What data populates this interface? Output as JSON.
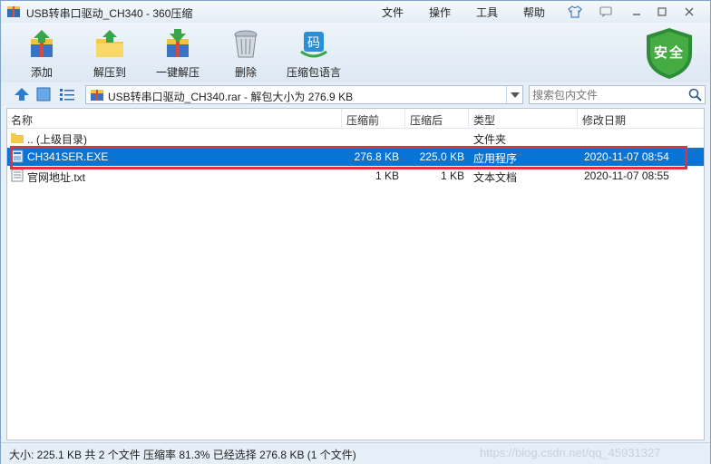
{
  "window": {
    "title": "USB转串口驱动_CH340 - 360压缩",
    "menu": [
      "文件",
      "操作",
      "工具",
      "帮助"
    ]
  },
  "toolbar": {
    "buttons": [
      {
        "label": "添加",
        "icon": "add-archive-icon"
      },
      {
        "label": "解压到",
        "icon": "extract-to-icon"
      },
      {
        "label": "一键解压",
        "icon": "one-click-extract-icon"
      },
      {
        "label": "删除",
        "icon": "trash-icon"
      },
      {
        "label": "压缩包语言",
        "icon": "archive-language-icon"
      }
    ],
    "badge_label": "安全"
  },
  "address": {
    "path": "USB转串口驱动_CH340.rar - 解包大小为 276.9 KB",
    "search_placeholder": "搜索包内文件"
  },
  "list": {
    "columns": [
      "名称",
      "压缩前",
      "压缩后",
      "类型",
      "修改日期"
    ],
    "rows": [
      {
        "name": ".. (上级目录)",
        "before": "",
        "after": "",
        "type": "文件夹",
        "date": "",
        "icon": "folder-icon"
      },
      {
        "name": "CH341SER.EXE",
        "before": "276.8 KB",
        "after": "225.0 KB",
        "type": "应用程序",
        "date": "2020-11-07 08:54",
        "icon": "exe-file-icon",
        "selected": true
      },
      {
        "name": "官网地址.txt",
        "before": "1 KB",
        "after": "1 KB",
        "type": "文本文档",
        "date": "2020-11-07 08:55",
        "icon": "text-file-icon"
      }
    ]
  },
  "status": {
    "text": "大小: 225.1 KB 共 2 个文件 压缩率 81.3% 已经选择 276.8 KB (1 个文件)",
    "watermark": "https://blog.csdn.net/qq_45931327"
  },
  "colors": {
    "selection": "#0a74d4",
    "highlight_box": "#e0323a",
    "shield": "#3aa03a"
  }
}
